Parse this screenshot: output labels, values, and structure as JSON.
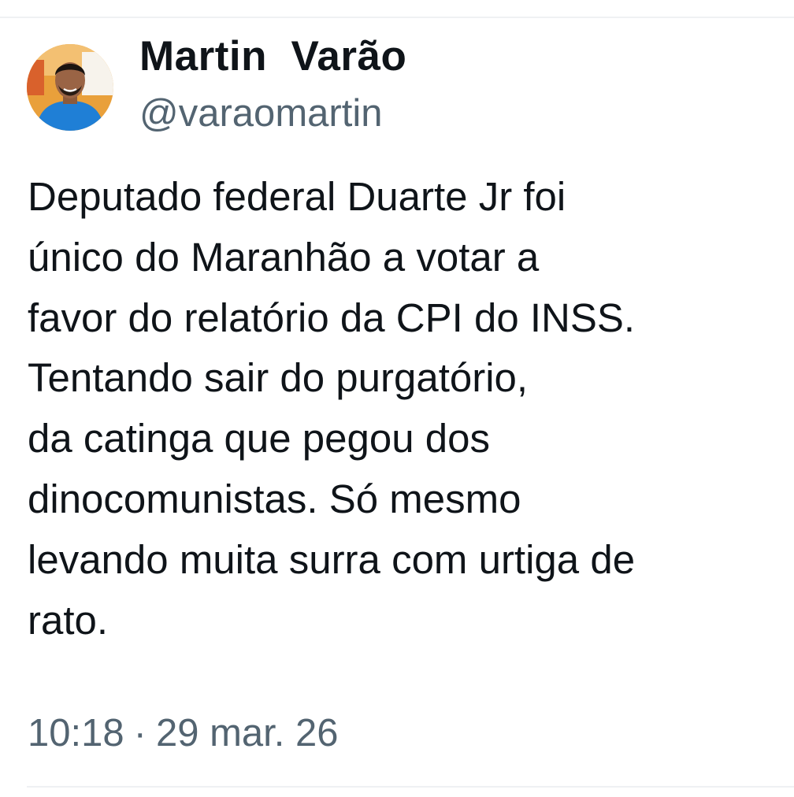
{
  "author": {
    "name": "Martin  Varão",
    "handle": "@varaomartin",
    "avatar_icon": "profile-photo"
  },
  "tweet": {
    "lines": [
      "Deputado federal Duarte Jr foi",
      "único do Maranhão a votar a",
      "favor do relatório da CPI do INSS.",
      "Tentando sair do purgatório,",
      "da catinga que pegou dos",
      "dinocomunistas. Só mesmo",
      "levando muita surra com urtiga de",
      "rato."
    ]
  },
  "meta": {
    "time": "10:18",
    "separator": "·",
    "date": "29 mar. 26"
  },
  "colors": {
    "text_primary": "#0f1419",
    "text_secondary": "#536471",
    "divider": "#eff1f3"
  }
}
